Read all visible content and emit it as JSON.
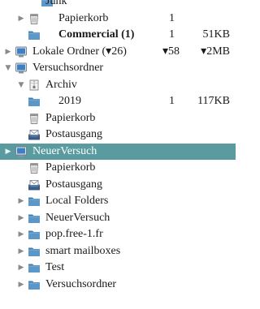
{
  "folders": [
    {
      "name": "Junk",
      "level": 3,
      "icon": "folder-icon",
      "twisty": "none"
    },
    {
      "name": "Papierkorb",
      "level": 2,
      "icon": "trash-icon",
      "twisty": "collapsed",
      "count": "1"
    },
    {
      "name": "Commercial (1)",
      "level": 2,
      "icon": "folder-icon",
      "twisty": "none",
      "bold": true,
      "count": "1",
      "size": "51KB"
    },
    {
      "name": "Lokale Ordner (▾26)",
      "level": 0,
      "icon": "account-icon",
      "twisty": "collapsed",
      "count": "▾58",
      "size": "▾2MB"
    },
    {
      "name": "Versuchsordner",
      "level": 0,
      "icon": "account-icon",
      "twisty": "expanded"
    },
    {
      "name": "Archiv",
      "level": 1,
      "icon": "archive-icon",
      "twisty": "expanded"
    },
    {
      "name": "2019",
      "level": 2,
      "icon": "folder-icon",
      "twisty": "none",
      "count": "1",
      "size": "117KB"
    },
    {
      "name": "Papierkorb",
      "level": 1,
      "icon": "trash-icon",
      "twisty": "none"
    },
    {
      "name": "Postausgang",
      "level": 1,
      "icon": "outbox-icon",
      "twisty": "none"
    },
    {
      "name": "NeuerVersuch",
      "level": 0,
      "icon": "account-icon",
      "twisty": "collapsed",
      "selected": true
    },
    {
      "name": "Papierkorb",
      "level": 1,
      "icon": "trash-icon",
      "twisty": "none"
    },
    {
      "name": "Postausgang",
      "level": 1,
      "icon": "outbox-icon",
      "twisty": "none"
    },
    {
      "name": "Local Folders",
      "level": 1,
      "icon": "folder-icon",
      "twisty": "collapsed"
    },
    {
      "name": "NeuerVersuch",
      "level": 1,
      "icon": "folder-icon",
      "twisty": "collapsed"
    },
    {
      "name": "pop.free-1.fr",
      "level": 1,
      "icon": "folder-icon",
      "twisty": "collapsed"
    },
    {
      "name": "smart mailboxes",
      "level": 1,
      "icon": "folder-icon",
      "twisty": "collapsed"
    },
    {
      "name": "Test",
      "level": 1,
      "icon": "folder-icon",
      "twisty": "collapsed"
    },
    {
      "name": "Versuchsordner",
      "level": 1,
      "icon": "folder-icon",
      "twisty": "collapsed"
    }
  ],
  "colors": {
    "folder": "#5b97c9",
    "folder_dark": "#3f7db3",
    "selection": "#5a9ba0",
    "twisty": "#8a8a8a"
  }
}
